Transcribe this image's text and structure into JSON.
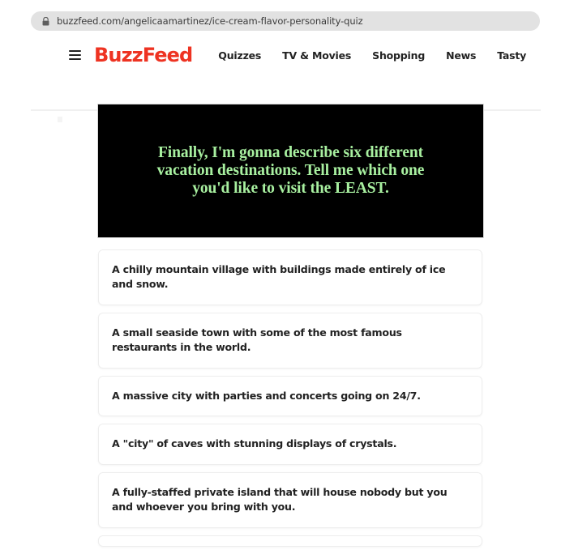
{
  "browser": {
    "url": "buzzfeed.com/angelicaamartinez/ice-cream-flavor-personality-quiz",
    "lock_icon": "lock-icon",
    "secure": "secure"
  },
  "site_header": {
    "menu_icon": "hamburger-menu-icon",
    "brand": "BuzzFeed",
    "brand_color": "#ee3322",
    "nav": [
      {
        "label": "Quizzes"
      },
      {
        "label": "TV & Movies"
      },
      {
        "label": "Shopping"
      },
      {
        "label": "News"
      },
      {
        "label": "Tasty"
      }
    ]
  },
  "quiz": {
    "question": "Finally, I'm gonna describe six different vacation destinations. Tell me which one you'd like to visit the LEAST.",
    "question_bg": "#000000",
    "question_color": "#a8f0a0",
    "options": [
      {
        "label": "A chilly mountain village with buildings made entirely of ice and snow."
      },
      {
        "label": "A small seaside town with some of the most famous restaurants in the world."
      },
      {
        "label": "A massive city with parties and concerts going on 24/7."
      },
      {
        "label": "A \"city\" of caves with stunning displays of crystals."
      },
      {
        "label": "A fully-staffed private island that will house nobody but you and whoever you bring with you."
      },
      {
        "label": ""
      }
    ]
  }
}
